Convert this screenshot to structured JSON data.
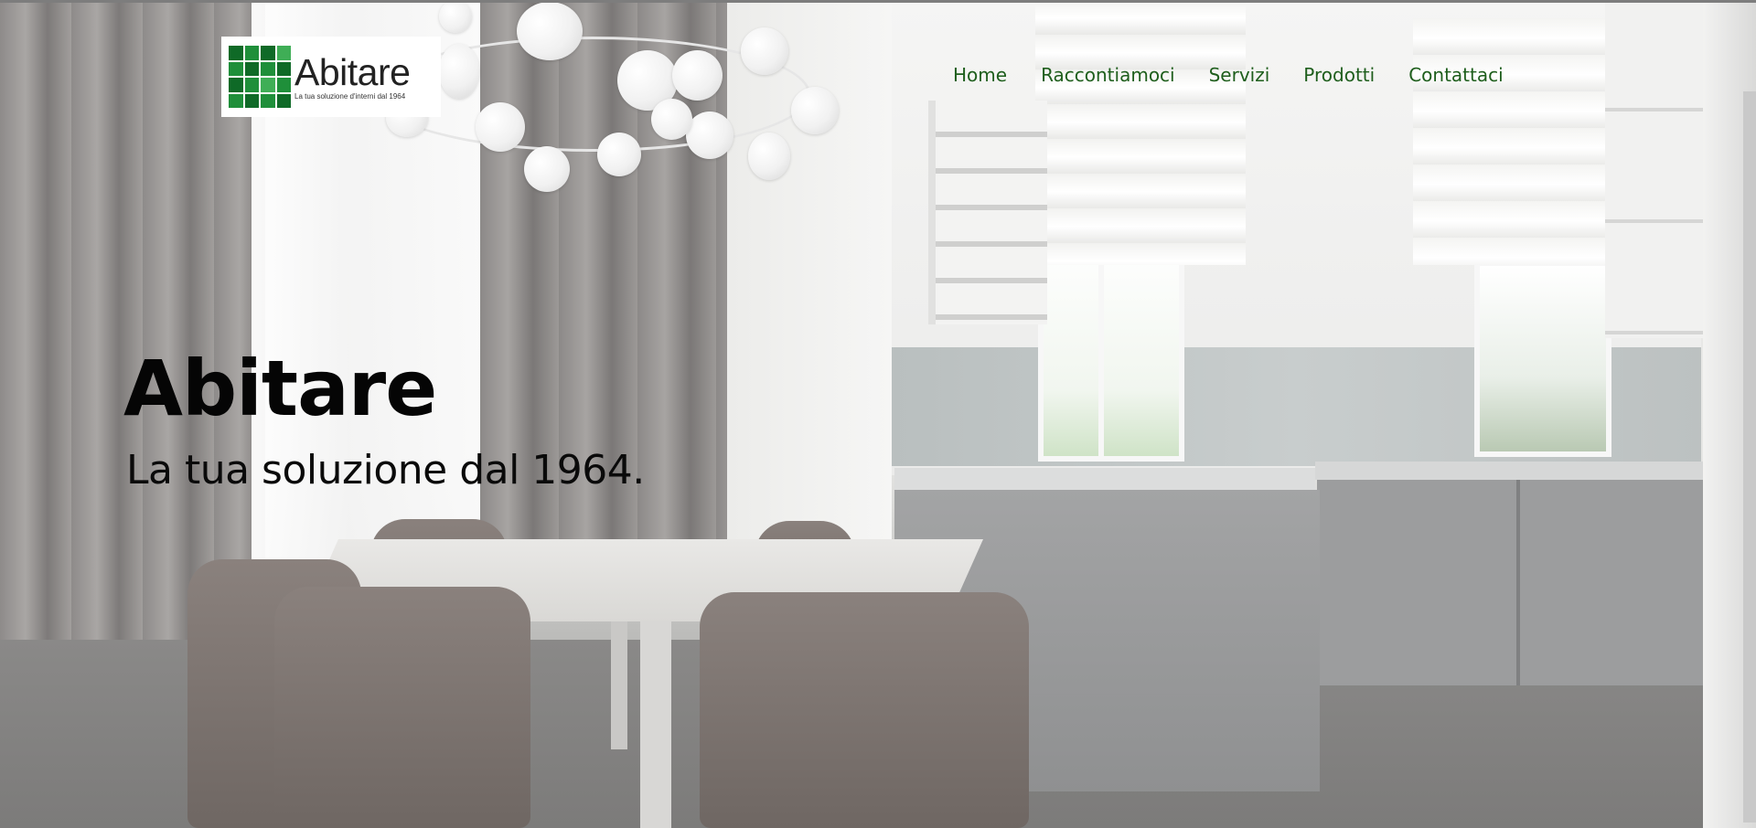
{
  "brand": {
    "name": "Abitare",
    "tagline": "La tua soluzione d'interni dal 1964",
    "colors": {
      "green": "#1f8f3a",
      "nav_text": "#1e5e1c"
    }
  },
  "nav": {
    "items": [
      {
        "label": "Home"
      },
      {
        "label": "Raccontiamoci"
      },
      {
        "label": "Servizi"
      },
      {
        "label": "Prodotti"
      },
      {
        "label": "Contattaci"
      }
    ]
  },
  "hero": {
    "title": "Abitare",
    "subtitle": "La tua soluzione dal 1964."
  }
}
